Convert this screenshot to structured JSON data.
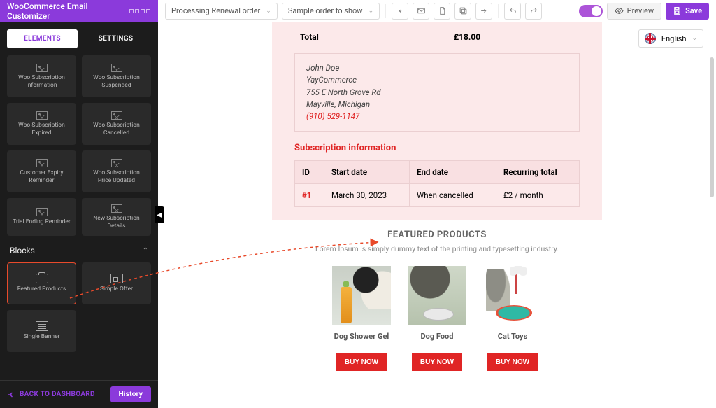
{
  "app": {
    "title": "WooCommerce Email Customizer"
  },
  "toolbar": {
    "template_select": "Processing Renewal order",
    "order_select": "Sample order to show",
    "preview_label": "Preview",
    "save_label": "Save"
  },
  "language": {
    "label": "English"
  },
  "sidebar": {
    "tabs": {
      "elements": "ELEMENTS",
      "settings": "SETTINGS"
    },
    "elements": [
      {
        "label": "Woo Subscription Information"
      },
      {
        "label": "Woo Subscription Suspended"
      },
      {
        "label": "Woo Subscription Expired"
      },
      {
        "label": "Woo Subscription Cancelled"
      },
      {
        "label": "Customer Expiry Reminder"
      },
      {
        "label": "Woo Subscription Price Updated"
      },
      {
        "label": "Trial Ending Reminder"
      },
      {
        "label": "New Subscription Details"
      }
    ],
    "blocks_title": "Blocks",
    "blocks": [
      {
        "label": "Featured Products"
      },
      {
        "label": "Simple Offer"
      },
      {
        "label": "Single Banner"
      }
    ],
    "back_label": "BACK TO DASHBOARD",
    "history_label": "History"
  },
  "email": {
    "total_label": "Total",
    "total_value": "£18.00",
    "address": {
      "name": "John Doe",
      "company": "YayCommerce",
      "street": "755 E North Grove Rd",
      "city": "Mayville, Michigan",
      "phone": "(910) 529-1147"
    },
    "sub_heading": "Subscription information",
    "sub_headers": {
      "id": "ID",
      "start": "Start date",
      "end": "End date",
      "total": "Recurring total"
    },
    "sub_row": {
      "id": "#1",
      "start": "March 30, 2023",
      "end": "When cancelled",
      "total": "£2 / month"
    }
  },
  "featured": {
    "title": "FEATURED PRODUCTS",
    "desc": "Lorem Ipsum is simply dummy text of the printing and typesetting industry.",
    "buy_label": "BUY NOW",
    "products": [
      {
        "name": "Dog Shower Gel"
      },
      {
        "name": "Dog Food"
      },
      {
        "name": "Cat Toys"
      }
    ]
  }
}
